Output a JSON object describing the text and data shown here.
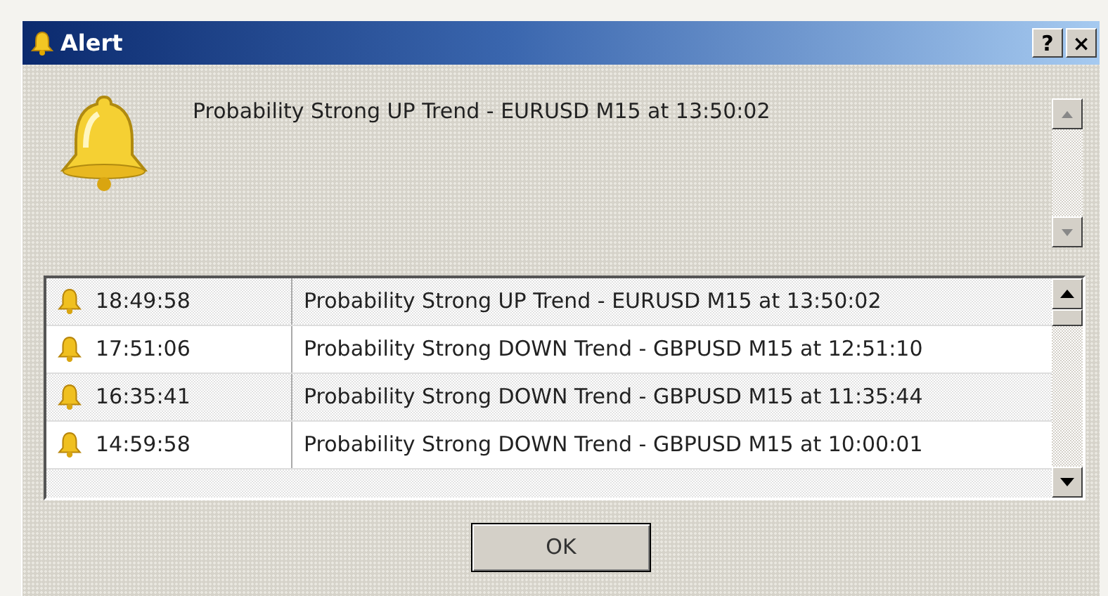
{
  "window": {
    "title": "Alert",
    "title_buttons": [
      "?",
      "×"
    ]
  },
  "message": "Probability Strong UP Trend - EURUSD M15 at 13:50:02",
  "alerts": [
    {
      "time": "18:49:58",
      "text": "Probability Strong UP Trend - EURUSD M15 at 13:50:02"
    },
    {
      "time": "17:51:06",
      "text": "Probability Strong DOWN Trend - GBPUSD M15 at 12:51:10"
    },
    {
      "time": "16:35:41",
      "text": "Probability Strong DOWN Trend - GBPUSD M15 at 11:35:44"
    },
    {
      "time": "14:59:58",
      "text": "Probability Strong DOWN Trend - GBPUSD M15 at 10:00:01"
    }
  ],
  "buttons": [
    "OK"
  ]
}
